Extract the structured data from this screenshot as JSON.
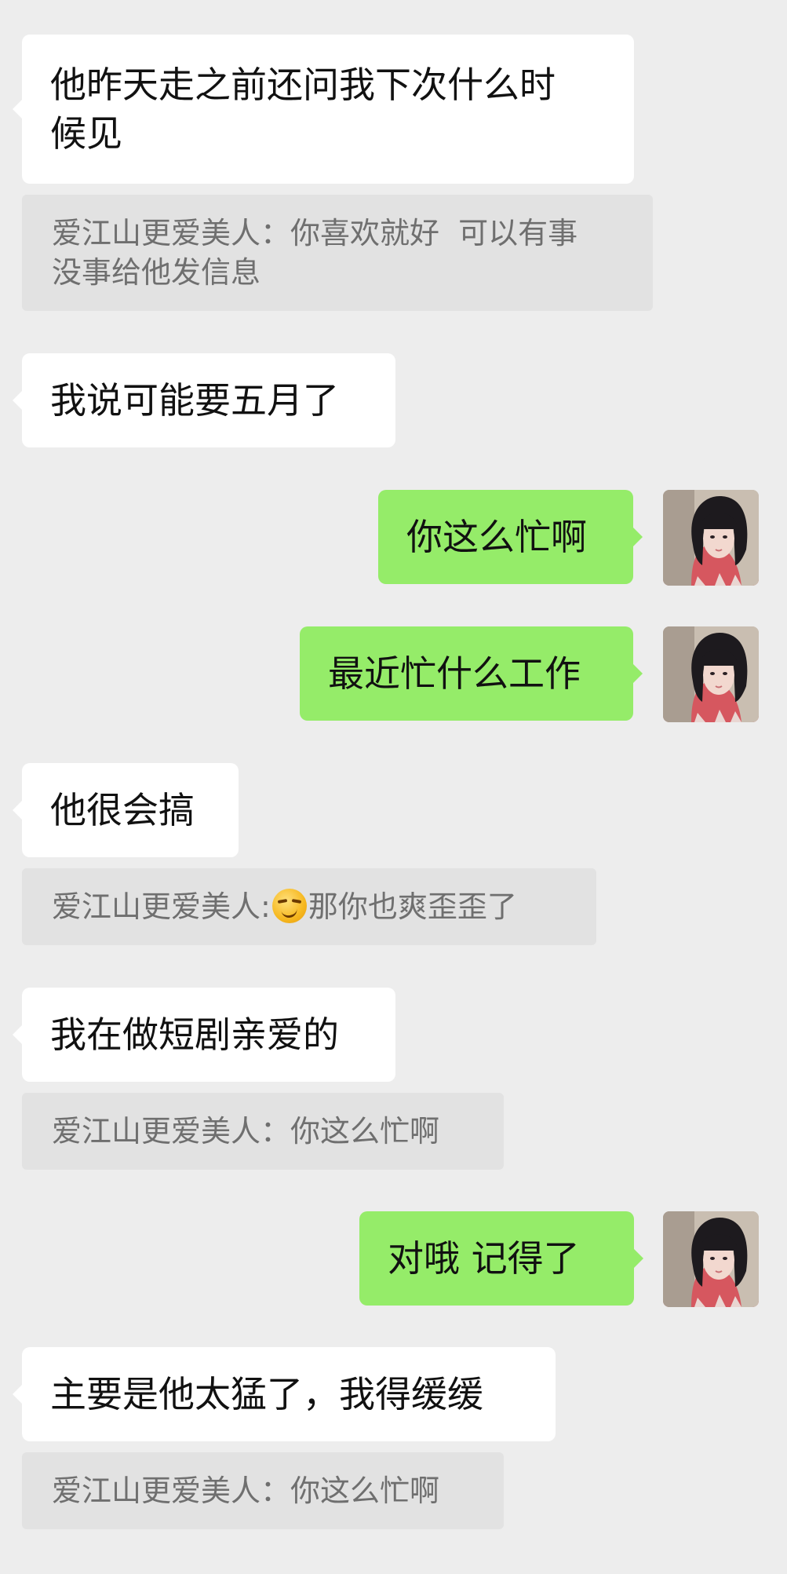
{
  "messages": [
    {
      "side": "in",
      "text": "他昨天走之前还问我下次什么时\n候见"
    },
    {
      "side": "quote",
      "text": "爱江山更爱美人：你喜欢就好  可以有事\n没事给他发信息"
    },
    {
      "side": "in",
      "text": "我说可能要五月了"
    },
    {
      "side": "out",
      "text": "你这么忙啊"
    },
    {
      "side": "out",
      "text": "最近忙什么工作"
    },
    {
      "side": "in",
      "text": "他很会搞"
    },
    {
      "side": "quote",
      "prefix": "爱江山更爱美人:",
      "emoji": "smirk-emoji",
      "suffix": "那你也爽歪歪了"
    },
    {
      "side": "in",
      "text": "我在做短剧亲爱的"
    },
    {
      "side": "quote",
      "text": "爱江山更爱美人：你这么忙啊"
    },
    {
      "side": "out",
      "text": "对哦 记得了"
    },
    {
      "side": "in",
      "text": "主要是他太猛了，我得缓缓"
    },
    {
      "side": "quote",
      "text": "爱江山更爱美人：你这么忙啊"
    }
  ],
  "colors": {
    "background": "#ededed",
    "incoming_bubble": "#ffffff",
    "outgoing_bubble": "#95ec69",
    "quote_bubble": "#e2e2e2",
    "quote_text": "#6f6f6f"
  },
  "avatar": {
    "icon": "user-avatar"
  }
}
